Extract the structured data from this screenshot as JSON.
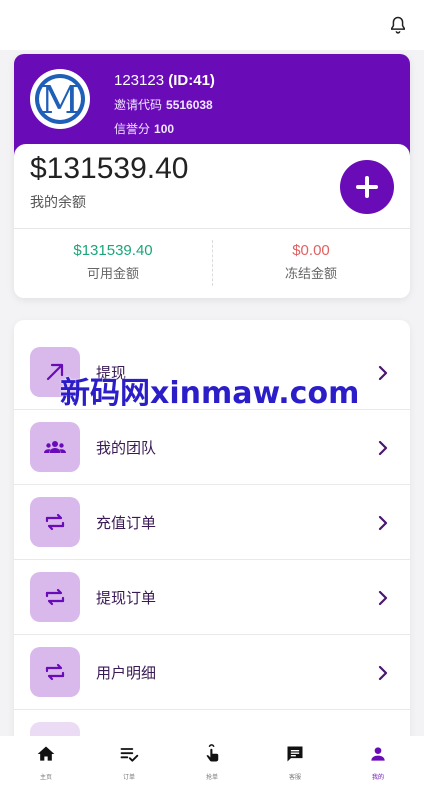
{
  "header": {
    "bell_icon": "bell-icon"
  },
  "profile": {
    "name": "123123",
    "id_text": "(ID:41)",
    "invite_label": "邀请代码",
    "invite_code": "5516038",
    "credit_label": "信誉分",
    "credit_value": "100",
    "avatar_letter": "M"
  },
  "balance": {
    "amount": "$131539.40",
    "label": "我的余额",
    "available_value": "$131539.40",
    "available_label": "可用金额",
    "frozen_value": "$0.00",
    "frozen_label": "冻结金额"
  },
  "menu": {
    "items": [
      {
        "label": "提现",
        "icon": "arrow-up-right-icon"
      },
      {
        "label": "我的团队",
        "icon": "group-icon"
      },
      {
        "label": "充值订单",
        "icon": "swap-icon"
      },
      {
        "label": "提现订单",
        "icon": "swap-icon"
      },
      {
        "label": "用户明细",
        "icon": "swap-icon"
      }
    ]
  },
  "watermark": {
    "text": "新码网xinmaw.com"
  },
  "tabbar": {
    "items": [
      {
        "label": "主页",
        "icon": "home-icon"
      },
      {
        "label": "订单",
        "icon": "list-check-icon"
      },
      {
        "label": "抢单",
        "icon": "tap-icon"
      },
      {
        "label": "客服",
        "icon": "chat-icon"
      },
      {
        "label": "我的",
        "icon": "person-icon"
      }
    ],
    "active_index": 4
  },
  "colors": {
    "primary": "#6a0bb8",
    "icon_bg": "#d9b8ec",
    "green": "#1aa67a",
    "red": "#e06262"
  }
}
